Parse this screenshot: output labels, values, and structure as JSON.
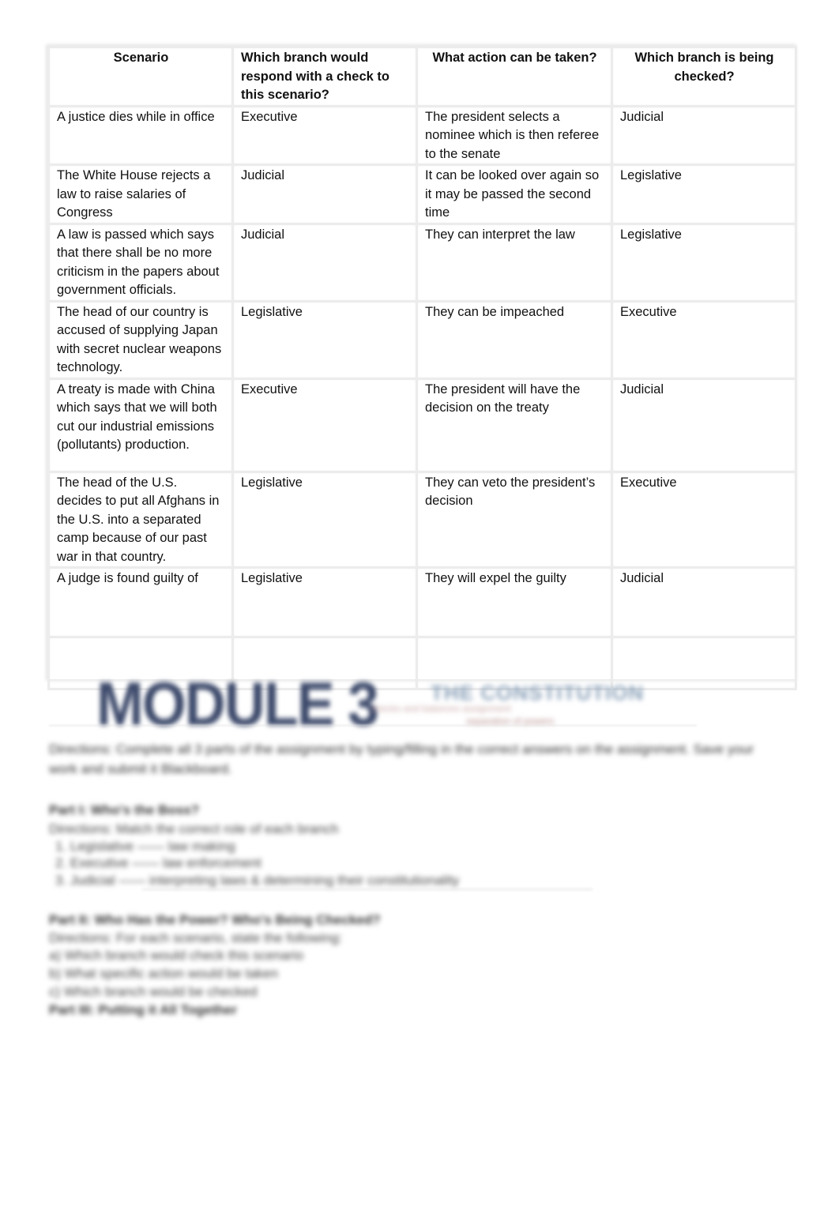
{
  "table": {
    "headers": [
      "Scenario",
      "Which branch would respond with a check to this scenario?",
      "What action can be taken?",
      "Which branch is being checked?"
    ],
    "rows": [
      {
        "scenario": "A justice dies while in office",
        "responding_branch": "Executive",
        "action": "The president selects a nominee which is then referee to the senate",
        "checked_branch": "Judicial"
      },
      {
        "scenario": "The White House rejects a law to raise salaries of Congress",
        "responding_branch": "Judicial",
        "action": "It can be looked over again so it may be passed the second time",
        "checked_branch": "Legislative"
      },
      {
        "scenario": "A law is passed which says that there shall be no more criticism in the papers about government officials.",
        "responding_branch": "Judicial",
        "action": "They can interpret the law",
        "checked_branch": "Legislative"
      },
      {
        "scenario": "The head of our country is accused of supplying Japan with secret nuclear weapons technology.",
        "responding_branch": "Legislative",
        "action": "They can be impeached",
        "checked_branch": "Executive"
      },
      {
        "scenario": "A treaty is made with China which says that we will both cut our industrial emissions (pollutants) production.",
        "responding_branch": "Executive",
        "action": "The president will have the decision on the treaty",
        "checked_branch": "Judicial"
      },
      {
        "scenario": "The head of the U.S. decides to put all Afghans in the U.S. into a separated camp because of our past war in that country.",
        "responding_branch": "Legislative",
        "action": "They can veto the president’s decision",
        "checked_branch": "Executive"
      },
      {
        "scenario": "A judge is found guilty of",
        "responding_branch": "Legislative",
        "action": "They will expel the guilty",
        "checked_branch": "Judicial"
      },
      {
        "scenario": "",
        "responding_branch": "",
        "action": "",
        "checked_branch": ""
      }
    ]
  },
  "blurred_preview": {
    "logo": "MODULE 3",
    "subtitle": "THE CONSTITUTION",
    "tagline": "checks and balances assignment",
    "tagline2": "separation of powers",
    "directions": "Directions: Complete all 3 parts of the assignment by typing/filling in the correct answers on the assignment. Save your work and submit it Blackboard.",
    "part1_title": "Part I: Who's the Boss?",
    "part1_directions": "Directions: Match the correct role of each branch",
    "part1_items": [
      "1. Legislative —— law making",
      "2. Executive —— law enforcement",
      "3. Judicial —— interpreting laws & determining their constitutionality"
    ],
    "part2_title": "Part II: Who Has the Power? Who's Being Checked?",
    "part2_lines": [
      "Directions: For each scenario, state the following:",
      "a) Which branch would check this scenario",
      "b) What specific action would be taken",
      "c) Which branch would be checked"
    ],
    "part3_title": "Part III: Putting it All Together"
  }
}
